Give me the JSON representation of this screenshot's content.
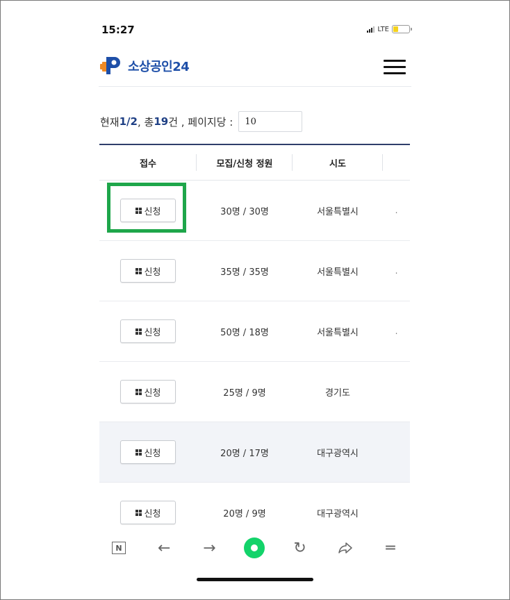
{
  "status_bar": {
    "time": "15:27",
    "network": "LTE"
  },
  "header": {
    "logo_text": "소상공인",
    "logo_number": "24"
  },
  "summary": {
    "prefix": "현재 ",
    "current_page": "1/2",
    "mid": " , 총 ",
    "total": "19",
    "suffix": "건 , 페이지당 :",
    "per_page_value": "10"
  },
  "table": {
    "headers": [
      "접수",
      "모집/신청 정원",
      "시도"
    ],
    "button_label": "신청",
    "rows": [
      {
        "quota": "30명 / 30명",
        "region": "서울특별시",
        "more": "."
      },
      {
        "quota": "35명 / 35명",
        "region": "서울특별시",
        "more": "."
      },
      {
        "quota": "50명 / 18명",
        "region": "서울특별시",
        "more": "."
      },
      {
        "quota": "25명 / 9명",
        "region": "경기도",
        "more": ""
      },
      {
        "quota": "20명 / 17명",
        "region": "대구광역시",
        "more": ""
      },
      {
        "quota": "20명 / 9명",
        "region": "대구광역시",
        "more": ""
      }
    ]
  },
  "toolbar": {
    "n_label": "N"
  },
  "colors": {
    "accent": "#1e4fa8",
    "highlight": "#1ea64a",
    "logo_orange": "#f08a24",
    "browser_green": "#13d36a"
  }
}
